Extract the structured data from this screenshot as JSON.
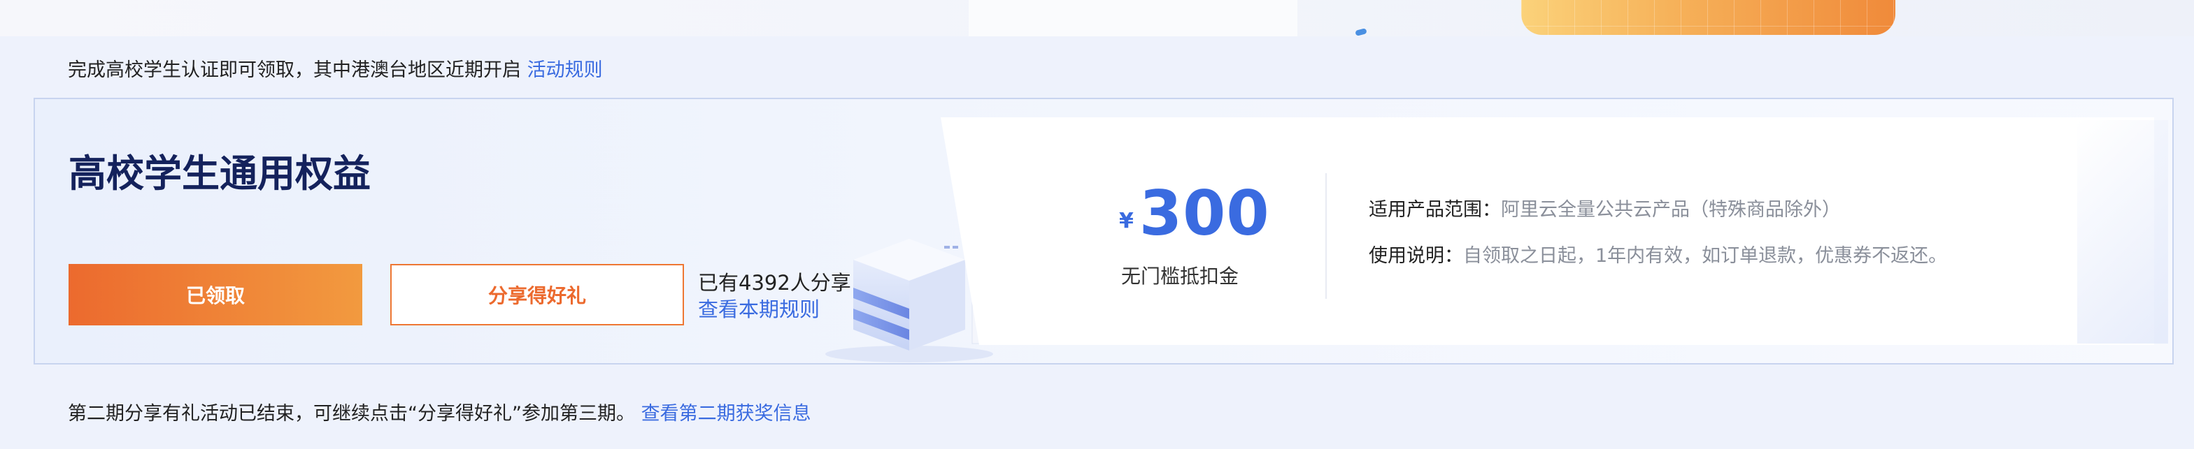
{
  "top_note": {
    "text": "完成高校学生认证即可领取，其中港澳台地区近期开启",
    "link": "活动规则"
  },
  "card": {
    "title": "高校学生通用权益",
    "claimed_button": "已领取",
    "share_button": "分享得好礼",
    "share_count": "已有4392人分享",
    "share_rules_link": "查看本期规则"
  },
  "coupon": {
    "currency": "¥",
    "amount": "300",
    "description": "无门槛抵扣金",
    "scope_label": "适用产品范围：",
    "scope_value": "阿里云全量公共云产品（特殊商品除外）",
    "usage_label": "使用说明：",
    "usage_value": "自领取之日起，1年内有效，如订单退款，优惠券不返还。"
  },
  "bottom_note": {
    "text": "第二期分享有礼活动已结束，可继续点击“分享得好礼”参加第三期。",
    "link": "查看第二期获奖信息"
  },
  "colors": {
    "accent_orange": "#ec6a2e",
    "link_blue": "#3a6be0",
    "title_navy": "#14225c"
  }
}
